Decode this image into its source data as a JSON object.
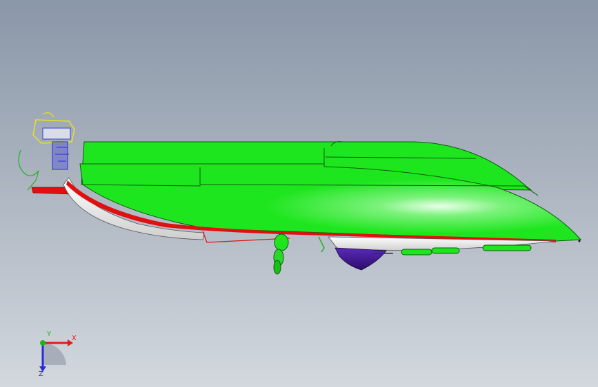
{
  "viewport": {
    "background_top": "#8a97a8",
    "background_bottom": "#d3d8de"
  },
  "model": {
    "hull_color": "#1ee61e",
    "hull_highlight": "#d6ffd6",
    "stripe_color": "#e01010",
    "underbody_color": "#f4f4f4",
    "keel_color": "#4b1e9e",
    "motor_outline_color": "#e8e21a",
    "motor_body_color": "#3a3ad6"
  },
  "triad": {
    "x_label": "X",
    "y_label": "Y",
    "z_label": "Z",
    "x_color": "#e01b1b",
    "y_color": "#1eb41e",
    "z_color": "#2a2ae0"
  }
}
